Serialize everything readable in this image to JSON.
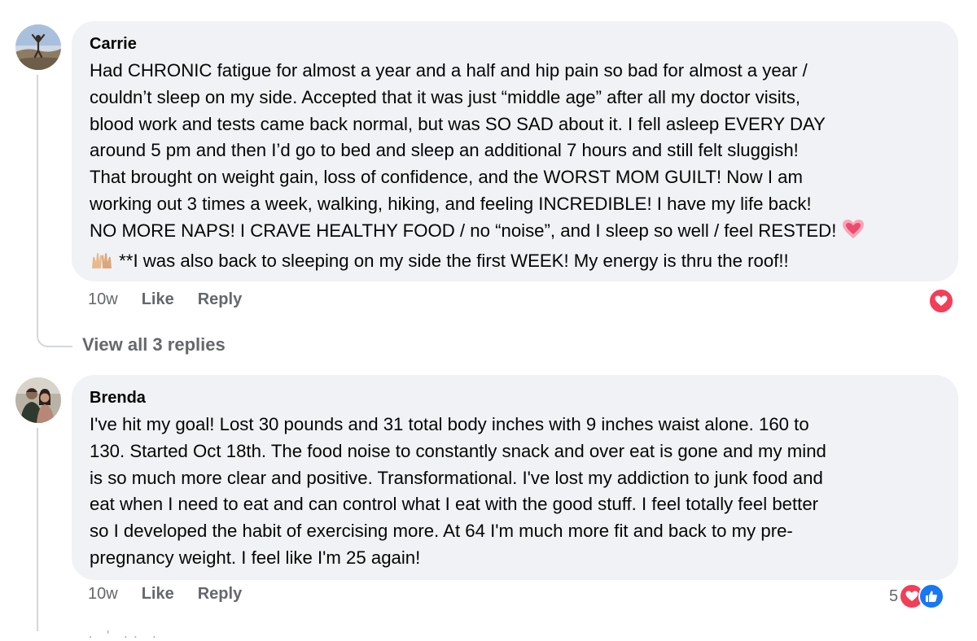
{
  "comments": [
    {
      "author": "Carrie",
      "lines": [
        "Had CHRONIC fatigue for almost a year and a half and hip pain so bad for almost a year /",
        "couldn’t sleep on my side. Accepted that it was just “middle age” after all my doctor visits,",
        "blood work and tests came back normal, but was SO SAD about it. I fell asleep EVERY DAY",
        "around 5 pm and then I’d go to bed and sleep an additional 7 hours and still felt sluggish!",
        "That brought on weight gain, loss of confidence, and the WORST MOM GUILT! Now I am",
        "working out 3 times a week, walking, hiking, and feeling INCREDIBLE! I have my life back!",
        "NO MORE NAPS! I CRAVE HEALTHY FOOD / no “noise”, and I sleep so well / feel RESTED!",
        "**I was also back to sleeping on my side the first WEEK! My energy is thru the roof!!"
      ],
      "emojis": [
        "growing-heart",
        "raised-hands"
      ],
      "time": "10w",
      "like_label": "Like",
      "reply_label": "Reply",
      "reactions": [
        "love"
      ],
      "view_replies": "View all 3 replies"
    },
    {
      "author": "Brenda",
      "lines": [
        "I've hit my goal! Lost 30 pounds and 31 total body inches with 9 inches waist alone. 160 to",
        "130. Started Oct 18th. The food noise to constantly snack and over eat is gone and my mind",
        "is so much more clear and positive. Transformational. I've lost my addiction to junk food and",
        "eat when I need to eat and can control what I eat with the good stuff. I feel totally feel better",
        "so I developed the habit of exercising more. At 64 I'm much more fit and back to my pre-",
        "pregnancy weight. I feel like I'm 25 again!"
      ],
      "time": "10w",
      "like_label": "Like",
      "reply_label": "Reply",
      "reaction_count": "5",
      "reactions": [
        "love",
        "like"
      ]
    }
  ],
  "colors": {
    "bubble_bg": "#f0f2f5",
    "secondary_text": "#65676b",
    "love": "#f33e58",
    "like": "#1877f2",
    "thread_line": "#d4d6da"
  }
}
